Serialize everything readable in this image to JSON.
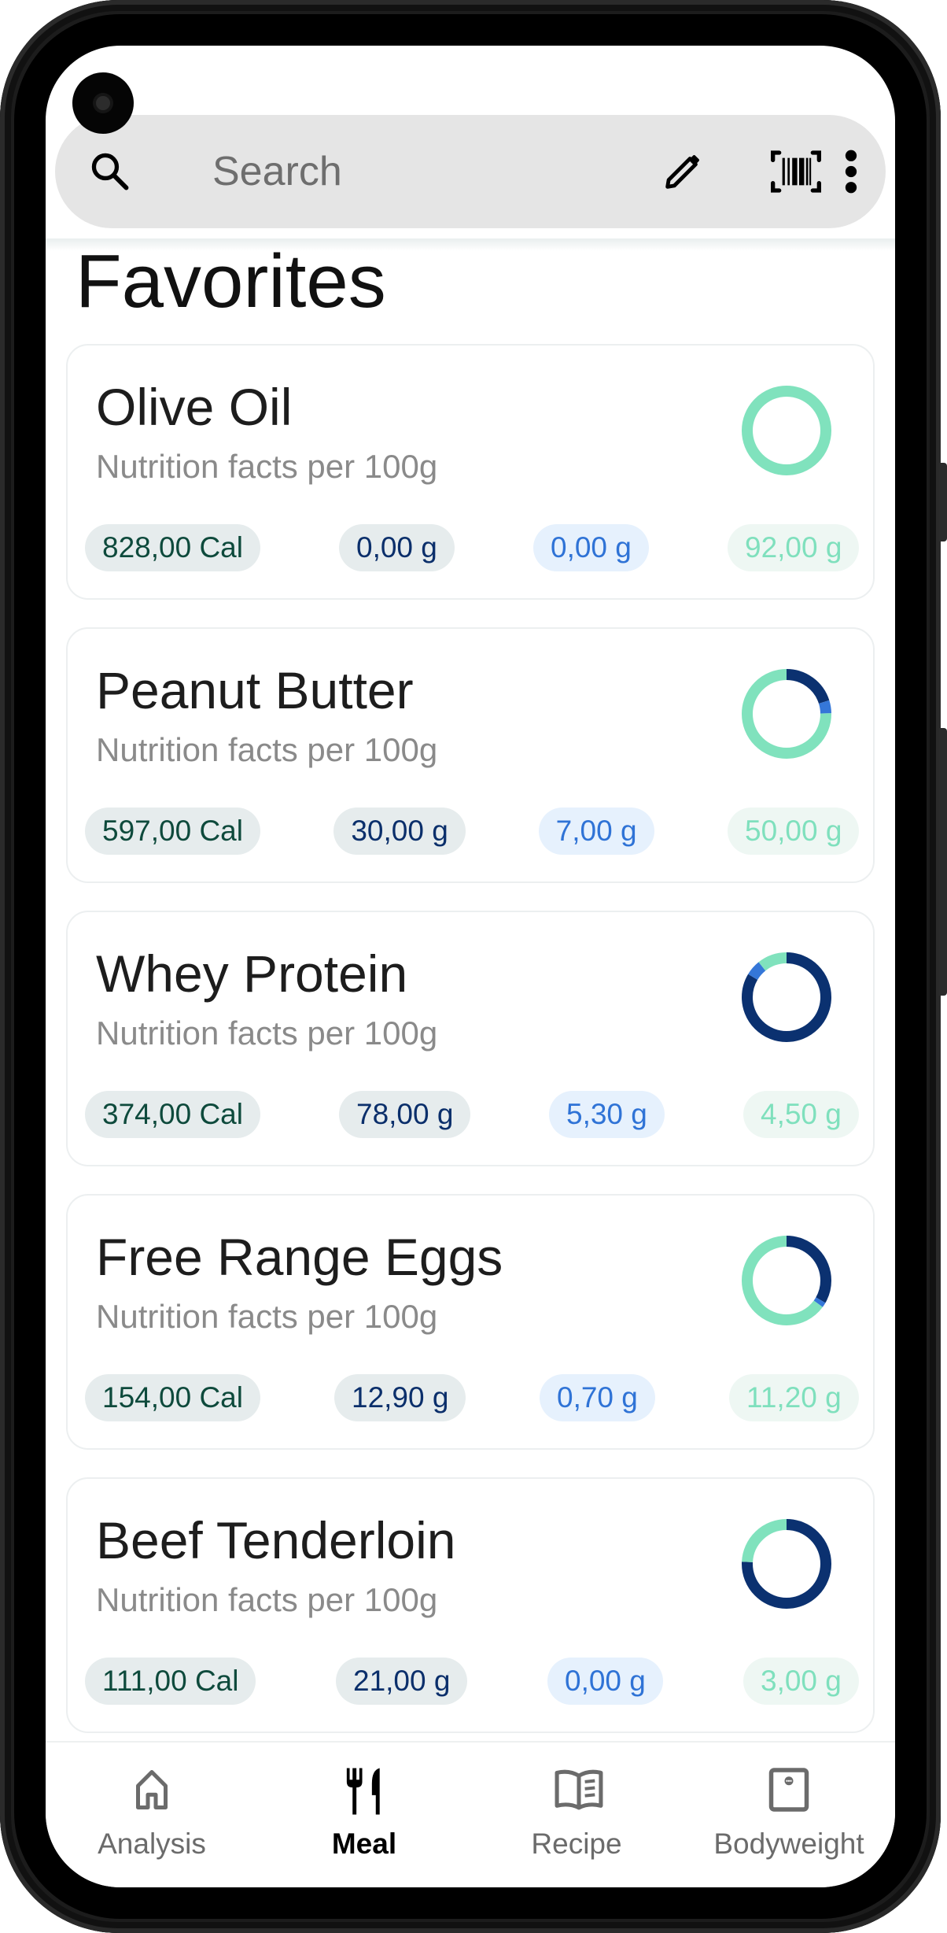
{
  "search": {
    "placeholder": "Search"
  },
  "toolbar": {
    "search_icon": "search-icon",
    "edit_icon": "pencil-icon",
    "barcode_icon": "barcode-scanner-icon",
    "more_icon": "more-vert-icon"
  },
  "page": {
    "title": "Favorites"
  },
  "colors": {
    "protein": "#0b3170",
    "carbs": "#3577d8",
    "fat": "#80e2bd",
    "calories_text": "#0e4a3c"
  },
  "foods": [
    {
      "name": "Olive Oil",
      "subtitle": "Nutrition facts per 100g",
      "calories": "828,00 Cal",
      "protein": "0,00 g",
      "carbs": "0,00 g",
      "fat": "92,00 g",
      "macros": {
        "protein": 0.0,
        "carbs": 0.0,
        "fat": 92.0
      }
    },
    {
      "name": "Peanut Butter",
      "subtitle": "Nutrition facts per 100g",
      "calories": "597,00 Cal",
      "protein": "30,00 g",
      "carbs": "7,00 g",
      "fat": "50,00 g",
      "macros": {
        "protein": 30.0,
        "carbs": 7.0,
        "fat": 50.0
      }
    },
    {
      "name": "Whey Protein",
      "subtitle": "Nutrition facts per 100g",
      "calories": "374,00 Cal",
      "protein": "78,00 g",
      "carbs": "5,30 g",
      "fat": "4,50 g",
      "macros": {
        "protein": 78.0,
        "carbs": 5.3,
        "fat": 4.5
      }
    },
    {
      "name": "Free Range Eggs",
      "subtitle": "Nutrition facts per 100g",
      "calories": "154,00 Cal",
      "protein": "12,90 g",
      "carbs": "0,70 g",
      "fat": "11,20 g",
      "macros": {
        "protein": 12.9,
        "carbs": 0.7,
        "fat": 11.2
      }
    },
    {
      "name": "Beef Tenderloin",
      "subtitle": "Nutrition facts per 100g",
      "calories": "111,00 Cal",
      "protein": "21,00 g",
      "carbs": "0,00 g",
      "fat": "3,00 g",
      "macros": {
        "protein": 21.0,
        "carbs": 0.0,
        "fat": 3.0
      }
    }
  ],
  "nav": {
    "items": [
      {
        "label": "Analysis",
        "icon": "home-icon",
        "active": false
      },
      {
        "label": "Meal",
        "icon": "restaurant-icon",
        "active": true
      },
      {
        "label": "Recipe",
        "icon": "menu-book-icon",
        "active": false
      },
      {
        "label": "Bodyweight",
        "icon": "scale-icon",
        "active": false
      }
    ]
  }
}
